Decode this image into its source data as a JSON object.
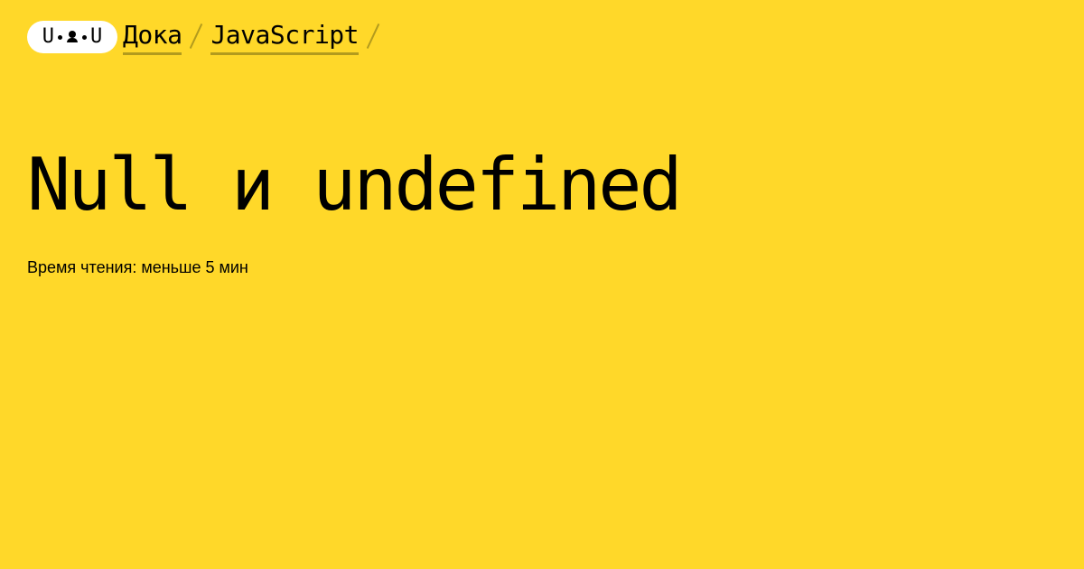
{
  "colors": {
    "background": "#ffd829",
    "logo_background": "#ffffff",
    "text": "#000000",
    "breadcrumb_underline": "#b39b1d",
    "separator": "#b39b1d"
  },
  "logo": {
    "left_letter": "U",
    "right_letter": "U",
    "face_icon": "bust-icon"
  },
  "breadcrumbs": [
    {
      "label": "Дока"
    },
    {
      "label": "JavaScript"
    }
  ],
  "article": {
    "title": "Null и undefined",
    "reading_time": "Время чтения: меньше 5 мин"
  }
}
